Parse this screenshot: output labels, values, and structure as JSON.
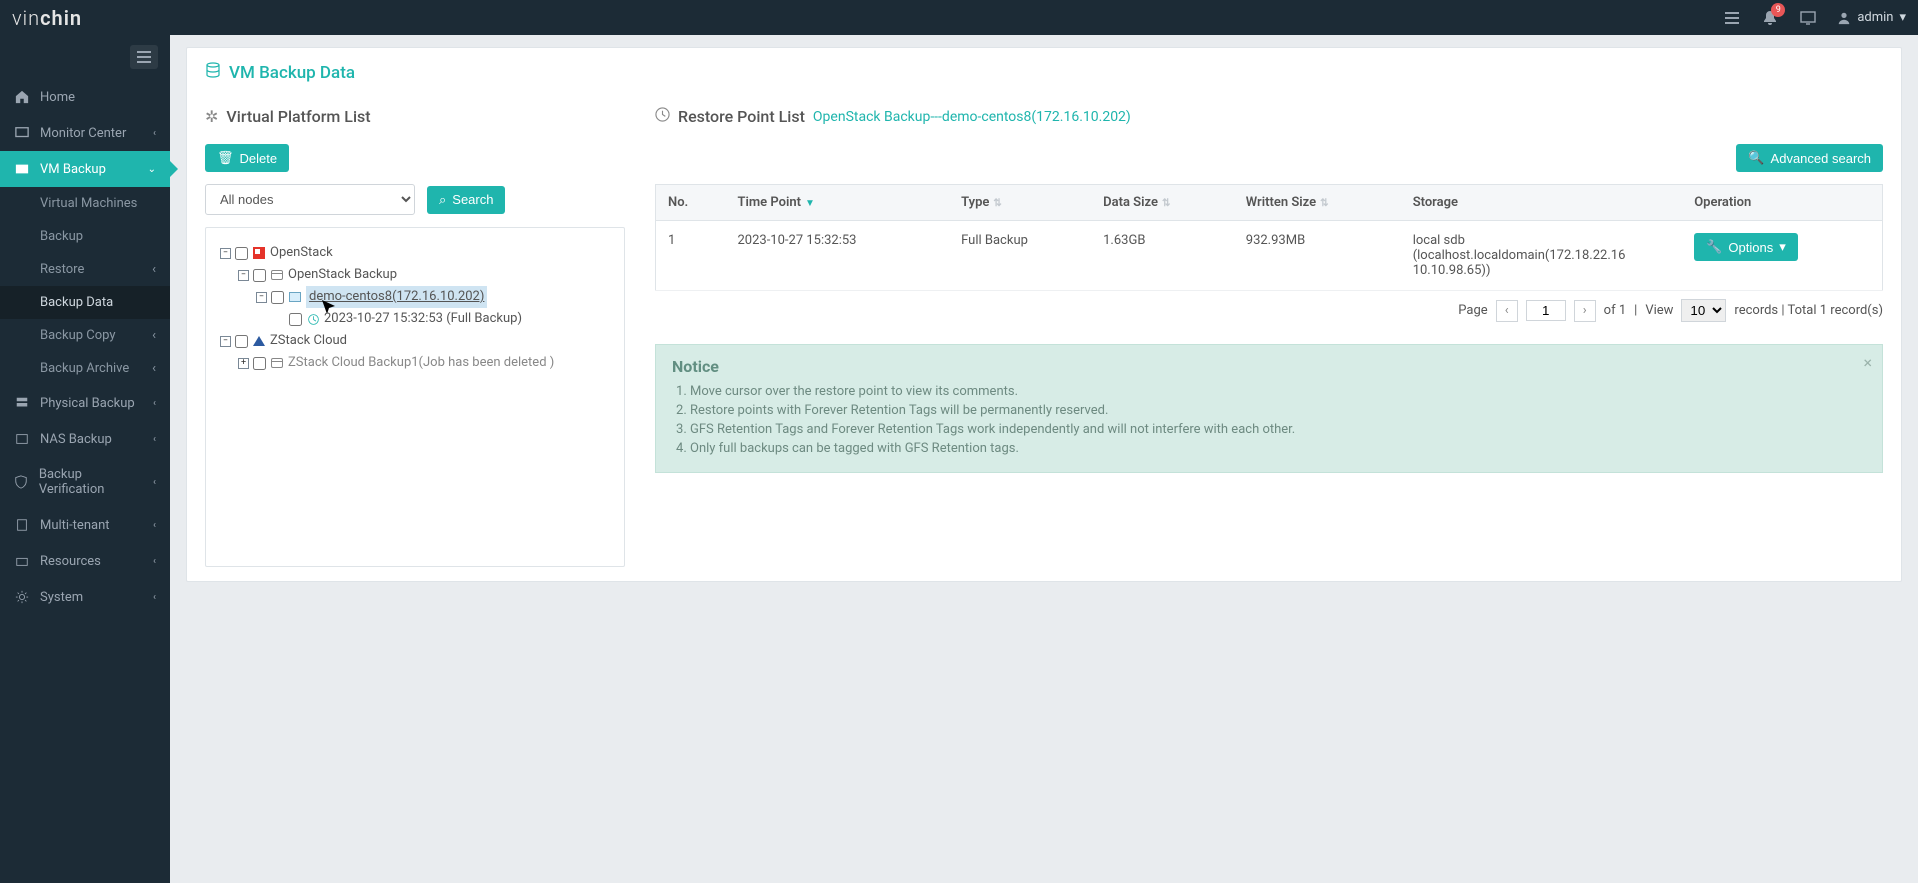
{
  "brand": {
    "a": "vin",
    "b": "chin"
  },
  "topbar": {
    "notif_count": "9",
    "username": "admin"
  },
  "sidebar": {
    "items": [
      {
        "label": "Home"
      },
      {
        "label": "Monitor Center"
      },
      {
        "label": "VM Backup"
      },
      {
        "label": "Physical Backup"
      },
      {
        "label": "NAS Backup"
      },
      {
        "label": "Backup Verification"
      },
      {
        "label": "Multi-tenant"
      },
      {
        "label": "Resources"
      },
      {
        "label": "System"
      }
    ],
    "vm_backup_sub": [
      {
        "label": "Virtual Machines"
      },
      {
        "label": "Backup"
      },
      {
        "label": "Restore"
      },
      {
        "label": "Backup Data"
      },
      {
        "label": "Backup Copy"
      },
      {
        "label": "Backup Archive"
      }
    ]
  },
  "page": {
    "title": "VM Backup Data"
  },
  "left": {
    "title": "Virtual Platform List",
    "delete_label": "Delete",
    "search_label": "Search",
    "node_select": "All nodes",
    "tree": {
      "openstack": "OpenStack",
      "openstack_backup": "OpenStack Backup",
      "vm_label": "demo-centos8(172.16.10.202)",
      "snapshot_label": "2023-10-27 15:32:53 (Full  Backup)",
      "zstack": "ZStack Cloud",
      "zstack_job": "ZStack Cloud Backup1(Job has been deleted )"
    }
  },
  "right": {
    "title": "Restore Point List",
    "trail": "OpenStack Backup---demo-centos8(172.16.10.202)",
    "adv_search": "Advanced search",
    "cols": {
      "no": "No.",
      "time": "Time Point",
      "type": "Type",
      "data": "Data Size",
      "written": "Written Size",
      "storage": "Storage",
      "op": "Operation"
    },
    "row": {
      "no": "1",
      "time": "2023-10-27 15:32:53",
      "type": "Full Backup",
      "data": "1.63GB",
      "written": "932.93MB",
      "storage": "local sdb (localhost.localdomain(172.18.22.16 10.10.98.65))",
      "options": "Options"
    },
    "pager": {
      "page_label": "Page",
      "page": "1",
      "of": "of 1",
      "view": "View",
      "per": "10",
      "tail": "records | Total 1 record(s)"
    },
    "notice": {
      "title": "Notice",
      "items": [
        "Move cursor over the restore point to view its comments.",
        "Restore points with Forever Retention Tags will be permanently reserved.",
        "GFS Retention Tags and Forever Retention Tags work independently and will not interfere with each other.",
        "Only full backups can be tagged with GFS Retention tags."
      ]
    }
  }
}
